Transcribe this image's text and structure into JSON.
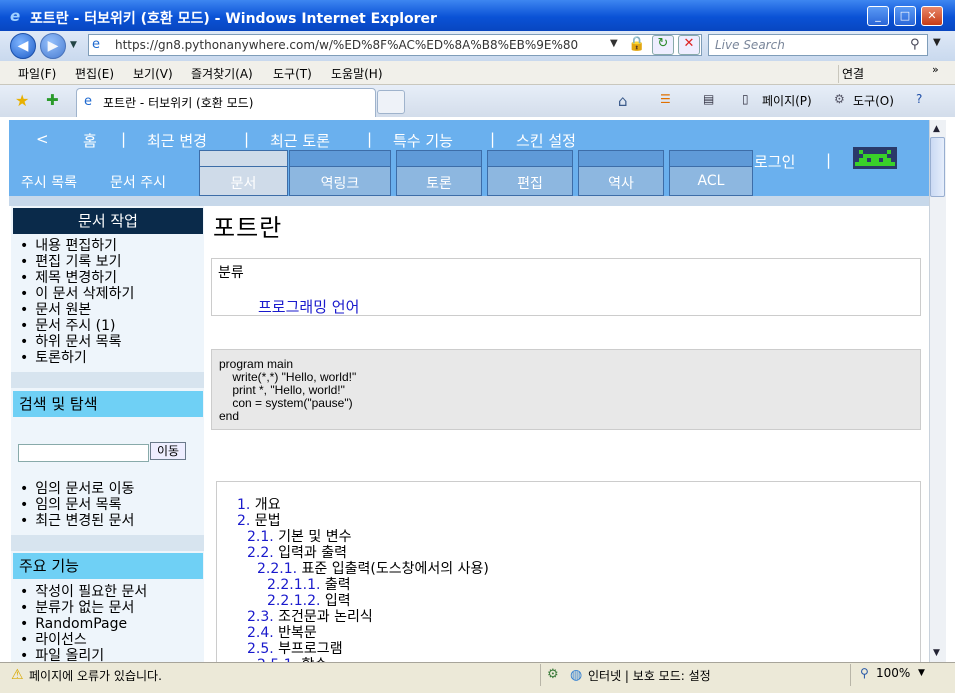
{
  "window": {
    "title": "포트란 - 터보위키 (호환 모드) - Windows Internet Explorer",
    "min": "_",
    "max": "□",
    "close": "✕"
  },
  "address": {
    "url": "https://gn8.pythonanywhere.com/w/%ED%8F%AC%ED%8A%B8%EB%9E%80",
    "search_placeholder": "Live Search"
  },
  "menu": [
    "파일(F)",
    "편집(E)",
    "보기(V)",
    "즐겨찾기(A)",
    "도구(T)",
    "도움말(H)"
  ],
  "links_label": "연결",
  "tab": {
    "title": "포트란 - 터보위키 (호환 모드)"
  },
  "commands": {
    "page": "페이지(P)",
    "tools": "도구(O)"
  },
  "wiki": {
    "nav": [
      "<",
      "홈",
      "|",
      "최근 변경",
      "|",
      "최근 토론",
      "|",
      "특수 기능",
      "|",
      "스킨 설정"
    ],
    "sub": [
      "주시 목록",
      "문서 주시"
    ],
    "tabs": [
      "문서",
      "역링크",
      "토론",
      "편집",
      "역사",
      "ACL"
    ],
    "login": "로그인",
    "login_sep": "|"
  },
  "sidebar": {
    "doc_title": "문서 작업",
    "doc_items": [
      "내용 편집하기",
      "편집 기록 보기",
      "제목 변경하기",
      "이 문서 삭제하기",
      "문서 원본",
      "문서 주시 (1)",
      "하위 문서 목록",
      "토론하기"
    ],
    "search_title": "검색 및 탐색",
    "go_button": "이동",
    "nav_items": [
      "임의 문서로 이동",
      "임의 문서 목록",
      "최근 변경된 문서"
    ],
    "main_title": "주요 기능",
    "main_items": [
      "작성이 필요한 문서",
      "분류가 없는 문서",
      "RandomPage",
      "라이선스",
      "파일 올리기"
    ]
  },
  "article": {
    "title": "포트란",
    "category_label": "분류",
    "category": "프로그래밍 언어",
    "code": [
      "program main",
      "    write(*,*) \"Hello, world!\"",
      "    print *, \"Hello, world!\"",
      "    con = system(\"pause\")",
      "end"
    ],
    "toc": [
      {
        "num": "1.",
        "text": " 개요",
        "level": 0
      },
      {
        "num": "2.",
        "text": " 문법",
        "level": 0
      },
      {
        "num": "2.1.",
        "text": " 기본 및 변수",
        "level": 1
      },
      {
        "num": "2.2.",
        "text": " 입력과 출력",
        "level": 1
      },
      {
        "num": "2.2.1.",
        "text": " 표준 입출력(도스창에서의 사용)",
        "level": 2
      },
      {
        "num": "2.2.1.1.",
        "text": " 출력",
        "level": 3
      },
      {
        "num": "2.2.1.2.",
        "text": " 입력",
        "level": 3
      },
      {
        "num": "2.3.",
        "text": " 조건문과 논리식",
        "level": 1
      },
      {
        "num": "2.4.",
        "text": " 반복문",
        "level": 1
      },
      {
        "num": "2.5.",
        "text": " 부프로그램",
        "level": 1
      },
      {
        "num": "2.5.1.",
        "text": " 함수",
        "level": 2
      }
    ]
  },
  "status": {
    "text": "페이지에 오류가 있습니다.",
    "zone": "인터넷 | 보호 모드: 설정",
    "zoom": "100%"
  }
}
